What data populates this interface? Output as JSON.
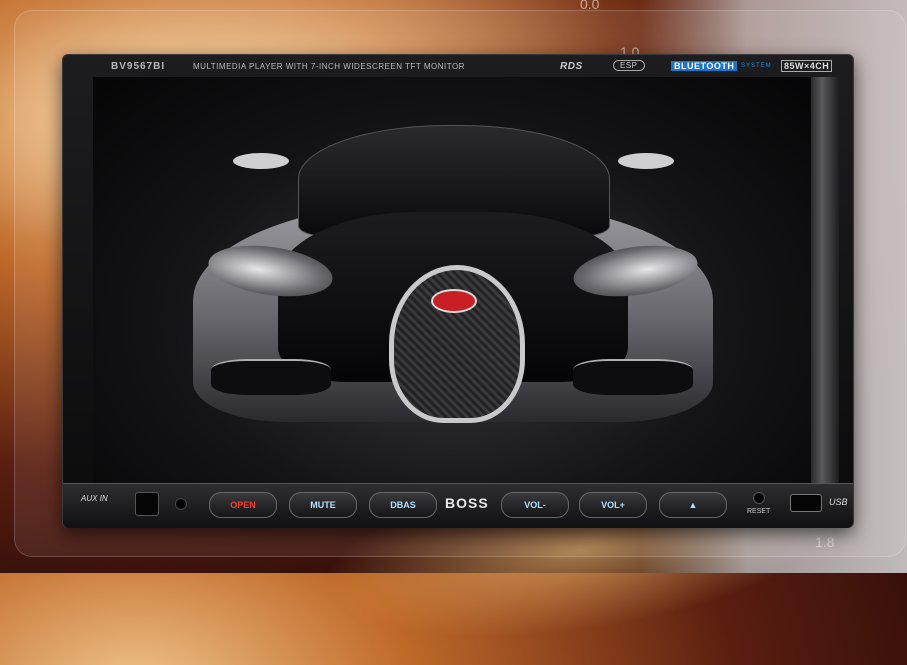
{
  "header": {
    "model": "BV9567BI",
    "tagline": "MULTIMEDIA PLAYER WITH 7-INCH WIDESCREEN TFT MONITOR",
    "rds": "RDS",
    "esp": "ESP",
    "bluetooth": "BLUETOOTH",
    "bluetooth_system": "SYSTEM",
    "power": "85W×4CH"
  },
  "controls": {
    "aux": "AUX IN",
    "power_label": "OPEN",
    "mute_label": "MUTE",
    "dbas_label": "DBAS",
    "brand": "BOSS",
    "vol_down_label": "VOL-",
    "vol_up_label": "VOL+",
    "eject_label": "▲",
    "reset_label": "RESET",
    "usb_label": "USB"
  },
  "background": {
    "scale_top": "0.0",
    "scale_mid": "1.0",
    "scale_bottom": "1.8"
  }
}
